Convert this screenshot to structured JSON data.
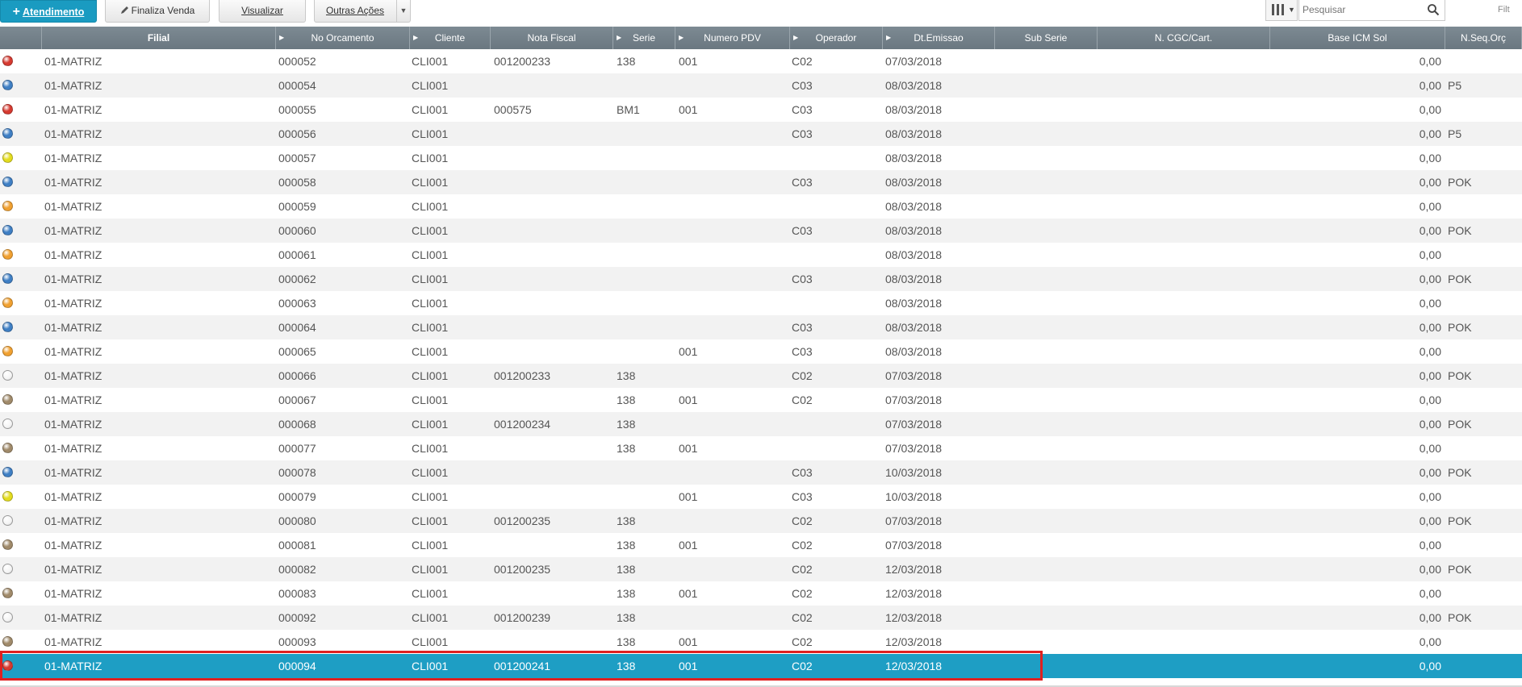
{
  "toolbar": {
    "atendimento_plus": "+",
    "atendimento_label": "Atendimento",
    "finaliza_label": "Finaliza Venda",
    "visualizar_label": "Visualizar",
    "outras_label": "Outras Ações",
    "search_placeholder": "Pesquisar",
    "filter_label": "Filt"
  },
  "columns": [
    "",
    "Filial",
    "No Orcamento",
    "Cliente",
    "Nota Fiscal",
    "Serie",
    "Numero PDV",
    "Operador",
    "Dt.Emissao",
    "Sub Serie",
    "N. CGC/Cart.",
    "Base ICM Sol",
    "N.Seq.Orç"
  ],
  "legend_colors": {
    "red": "#d63a30",
    "blue": "#3f7fc4",
    "yellow": "#e3dc1e",
    "orange": "#f0a030",
    "white": "#f4f4f4",
    "brown": "#a08a6a"
  },
  "rows": [
    {
      "status": "red",
      "filial": "01-MATRIZ",
      "orcamento": "000052",
      "cliente": "CLI001",
      "nota": "001200233",
      "serie": "138",
      "pdv": "001",
      "operador": "C02",
      "emissao": "07/03/2018",
      "base": "0,00",
      "seq": ""
    },
    {
      "status": "blue",
      "filial": "01-MATRIZ",
      "orcamento": "000054",
      "cliente": "CLI001",
      "nota": "",
      "serie": "",
      "pdv": "",
      "operador": "C03",
      "emissao": "08/03/2018",
      "base": "0,00",
      "seq": "P5"
    },
    {
      "status": "red",
      "filial": "01-MATRIZ",
      "orcamento": "000055",
      "cliente": "CLI001",
      "nota": "000575",
      "serie": "BM1",
      "pdv": "001",
      "operador": "C03",
      "emissao": "08/03/2018",
      "base": "0,00",
      "seq": ""
    },
    {
      "status": "blue",
      "filial": "01-MATRIZ",
      "orcamento": "000056",
      "cliente": "CLI001",
      "nota": "",
      "serie": "",
      "pdv": "",
      "operador": "C03",
      "emissao": "08/03/2018",
      "base": "0,00",
      "seq": "P5"
    },
    {
      "status": "yellow",
      "filial": "01-MATRIZ",
      "orcamento": "000057",
      "cliente": "CLI001",
      "nota": "",
      "serie": "",
      "pdv": "",
      "operador": "",
      "emissao": "08/03/2018",
      "base": "0,00",
      "seq": ""
    },
    {
      "status": "blue",
      "filial": "01-MATRIZ",
      "orcamento": "000058",
      "cliente": "CLI001",
      "nota": "",
      "serie": "",
      "pdv": "",
      "operador": "C03",
      "emissao": "08/03/2018",
      "base": "0,00",
      "seq": "POK"
    },
    {
      "status": "orange",
      "filial": "01-MATRIZ",
      "orcamento": "000059",
      "cliente": "CLI001",
      "nota": "",
      "serie": "",
      "pdv": "",
      "operador": "",
      "emissao": "08/03/2018",
      "base": "0,00",
      "seq": ""
    },
    {
      "status": "blue",
      "filial": "01-MATRIZ",
      "orcamento": "000060",
      "cliente": "CLI001",
      "nota": "",
      "serie": "",
      "pdv": "",
      "operador": "C03",
      "emissao": "08/03/2018",
      "base": "0,00",
      "seq": "POK"
    },
    {
      "status": "orange",
      "filial": "01-MATRIZ",
      "orcamento": "000061",
      "cliente": "CLI001",
      "nota": "",
      "serie": "",
      "pdv": "",
      "operador": "",
      "emissao": "08/03/2018",
      "base": "0,00",
      "seq": ""
    },
    {
      "status": "blue",
      "filial": "01-MATRIZ",
      "orcamento": "000062",
      "cliente": "CLI001",
      "nota": "",
      "serie": "",
      "pdv": "",
      "operador": "C03",
      "emissao": "08/03/2018",
      "base": "0,00",
      "seq": "POK"
    },
    {
      "status": "orange",
      "filial": "01-MATRIZ",
      "orcamento": "000063",
      "cliente": "CLI001",
      "nota": "",
      "serie": "",
      "pdv": "",
      "operador": "",
      "emissao": "08/03/2018",
      "base": "0,00",
      "seq": ""
    },
    {
      "status": "blue",
      "filial": "01-MATRIZ",
      "orcamento": "000064",
      "cliente": "CLI001",
      "nota": "",
      "serie": "",
      "pdv": "",
      "operador": "C03",
      "emissao": "08/03/2018",
      "base": "0,00",
      "seq": "POK"
    },
    {
      "status": "orange",
      "filial": "01-MATRIZ",
      "orcamento": "000065",
      "cliente": "CLI001",
      "nota": "",
      "serie": "",
      "pdv": "001",
      "operador": "C03",
      "emissao": "08/03/2018",
      "base": "0,00",
      "seq": ""
    },
    {
      "status": "white",
      "filial": "01-MATRIZ",
      "orcamento": "000066",
      "cliente": "CLI001",
      "nota": "001200233",
      "serie": "138",
      "pdv": "",
      "operador": "C02",
      "emissao": "07/03/2018",
      "base": "0,00",
      "seq": "POK"
    },
    {
      "status": "brown",
      "filial": "01-MATRIZ",
      "orcamento": "000067",
      "cliente": "CLI001",
      "nota": "",
      "serie": "138",
      "pdv": "001",
      "operador": "C02",
      "emissao": "07/03/2018",
      "base": "0,00",
      "seq": ""
    },
    {
      "status": "white",
      "filial": "01-MATRIZ",
      "orcamento": "000068",
      "cliente": "CLI001",
      "nota": "001200234",
      "serie": "138",
      "pdv": "",
      "operador": "",
      "emissao": "07/03/2018",
      "base": "0,00",
      "seq": "POK"
    },
    {
      "status": "brown",
      "filial": "01-MATRIZ",
      "orcamento": "000077",
      "cliente": "CLI001",
      "nota": "",
      "serie": "138",
      "pdv": "001",
      "operador": "",
      "emissao": "07/03/2018",
      "base": "0,00",
      "seq": ""
    },
    {
      "status": "blue",
      "filial": "01-MATRIZ",
      "orcamento": "000078",
      "cliente": "CLI001",
      "nota": "",
      "serie": "",
      "pdv": "",
      "operador": "C03",
      "emissao": "10/03/2018",
      "base": "0,00",
      "seq": "POK"
    },
    {
      "status": "yellow",
      "filial": "01-MATRIZ",
      "orcamento": "000079",
      "cliente": "CLI001",
      "nota": "",
      "serie": "",
      "pdv": "001",
      "operador": "C03",
      "emissao": "10/03/2018",
      "base": "0,00",
      "seq": ""
    },
    {
      "status": "white",
      "filial": "01-MATRIZ",
      "orcamento": "000080",
      "cliente": "CLI001",
      "nota": "001200235",
      "serie": "138",
      "pdv": "",
      "operador": "C02",
      "emissao": "07/03/2018",
      "base": "0,00",
      "seq": "POK"
    },
    {
      "status": "brown",
      "filial": "01-MATRIZ",
      "orcamento": "000081",
      "cliente": "CLI001",
      "nota": "",
      "serie": "138",
      "pdv": "001",
      "operador": "C02",
      "emissao": "07/03/2018",
      "base": "0,00",
      "seq": ""
    },
    {
      "status": "white",
      "filial": "01-MATRIZ",
      "orcamento": "000082",
      "cliente": "CLI001",
      "nota": "001200235",
      "serie": "138",
      "pdv": "",
      "operador": "C02",
      "emissao": "12/03/2018",
      "base": "0,00",
      "seq": "POK"
    },
    {
      "status": "brown",
      "filial": "01-MATRIZ",
      "orcamento": "000083",
      "cliente": "CLI001",
      "nota": "",
      "serie": "138",
      "pdv": "001",
      "operador": "C02",
      "emissao": "12/03/2018",
      "base": "0,00",
      "seq": ""
    },
    {
      "status": "white",
      "filial": "01-MATRIZ",
      "orcamento": "000092",
      "cliente": "CLI001",
      "nota": "001200239",
      "serie": "138",
      "pdv": "",
      "operador": "C02",
      "emissao": "12/03/2018",
      "base": "0,00",
      "seq": "POK"
    },
    {
      "status": "brown",
      "filial": "01-MATRIZ",
      "orcamento": "000093",
      "cliente": "CLI001",
      "nota": "",
      "serie": "138",
      "pdv": "001",
      "operador": "C02",
      "emissao": "12/03/2018",
      "base": "0,00",
      "seq": ""
    },
    {
      "status": "red",
      "filial": "01-MATRIZ",
      "orcamento": "000094",
      "cliente": "CLI001",
      "nota": "001200241",
      "serie": "138",
      "pdv": "001",
      "operador": "C02",
      "emissao": "12/03/2018",
      "base": "0,00",
      "seq": "",
      "selected": true
    }
  ]
}
